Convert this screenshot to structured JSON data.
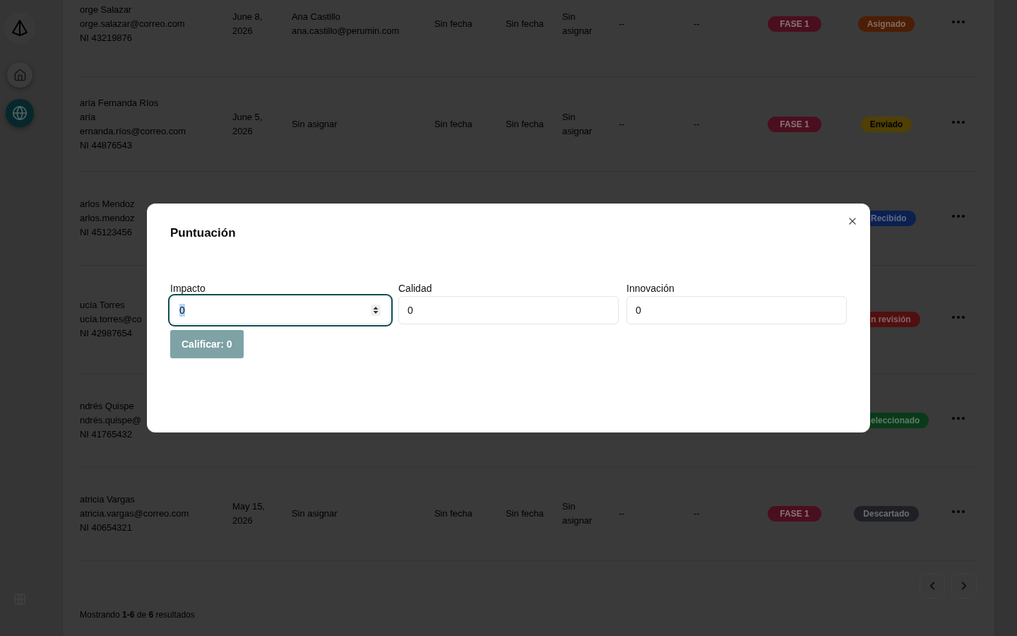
{
  "sidebar": {
    "nav": [
      {
        "selected": false
      },
      {
        "selected": true
      }
    ]
  },
  "table": {
    "rows": [
      {
        "column_1": [
          "orge Salazar",
          "orge.salazar@correo.com",
          "NI 43219876"
        ],
        "column_2": "June 8, 2026",
        "column_3": [
          "Ana Castillo",
          "ana.castillo@perumin.com"
        ],
        "column_4": "Sin fecha",
        "column_5": "Sin fecha",
        "column_6": "Sin asignar",
        "column_7": "--",
        "column_8": "--",
        "column_9": "FASE 1",
        "column_10": {
          "label": "Asignado",
          "color": "#4b1e05"
        }
      },
      {
        "column_1": [
          "aría Fernanda Ríos",
          "aría",
          "ernanda.ríos@correo.com",
          "NI 44876543"
        ],
        "column_2": "June 5, 2026",
        "column_3": [
          "Sin asignar"
        ],
        "column_4": "Sin fecha",
        "column_5": "Sin fecha",
        "column_6": "Sin asignar",
        "column_7": "--",
        "column_8": "--",
        "column_9": "FASE 1",
        "column_10": {
          "label": "Enviado",
          "color": "#504006"
        }
      },
      {
        "column_1": [
          "arlos Mendoz",
          "arlos.mendoz",
          "NI 45123456"
        ],
        "column_10": {
          "label": "Recibido",
          "color": "#0c2050"
        }
      },
      {
        "column_1": [
          "ucía Torres",
          "ucía.torres@co",
          "NI 42987654"
        ],
        "column_10": {
          "label": "n revisión",
          "color": "#501010"
        }
      },
      {
        "column_1": [
          "ndrés Quispe",
          "ndrés.quispe@",
          "NI 41765432"
        ],
        "column_10": {
          "label": "eleccionado",
          "color": "#0a3a19"
        }
      },
      {
        "column_1": [
          "atricia Vargas",
          "atricia.vargas@correo.com",
          "NI 40654321"
        ],
        "column_2": "May 15, 2026",
        "column_3": [
          "Sin asignar"
        ],
        "column_4": "Sin fecha",
        "column_5": "Sin fecha",
        "column_6": "Sin asignar",
        "column_7": "--",
        "column_8": "--",
        "column_9": "FASE 1",
        "column_10": {
          "label": "Descartado",
          "color": "#1e2026"
        }
      }
    ],
    "summary": "Mostrando **1-6** de **6** resultados"
  },
  "dialog": {
    "title": "Puntuación",
    "fields": [
      {
        "label": "Impacto",
        "value": "0",
        "focused": true
      },
      {
        "label": "Calidad",
        "value": "0",
        "focused": false
      },
      {
        "label": "Innovación",
        "value": "0",
        "focused": false
      }
    ],
    "submit": {
      "label": "Calificar: 0",
      "disabled": true
    }
  }
}
